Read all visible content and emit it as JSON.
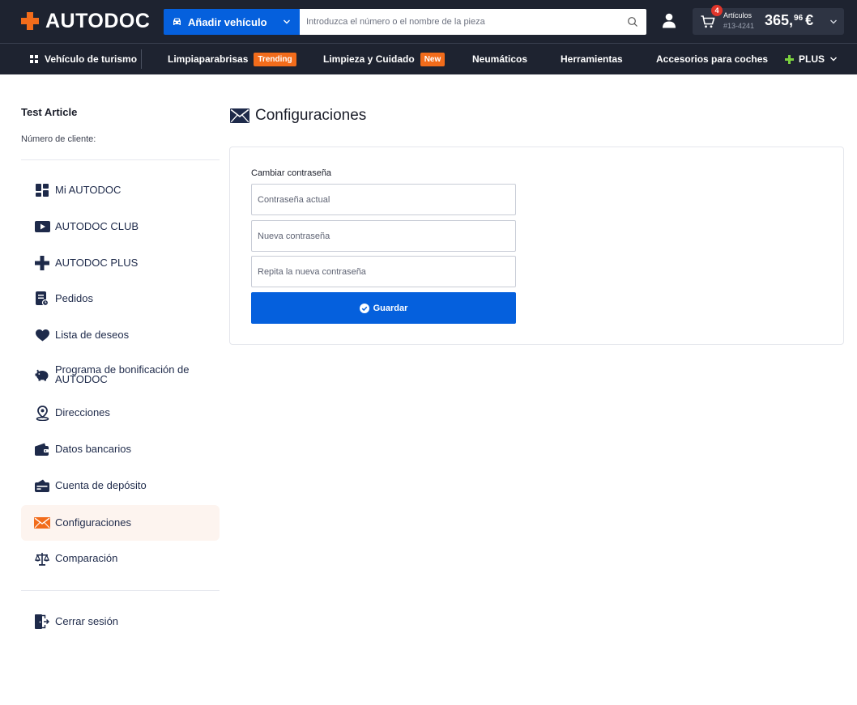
{
  "header": {
    "logo_text": "AUTODOC",
    "vehicle_button_label": "Añadir vehículo",
    "search_placeholder": "Introduzca el número o el nombre de la pieza",
    "cart": {
      "badge_count": "4",
      "items_label": "Artículos",
      "order_number": "#13-4241",
      "price_integer": "365,",
      "price_decimal": "96",
      "currency": "€"
    }
  },
  "nav": {
    "items": [
      {
        "label": "Vehículo de turismo"
      },
      {
        "label": "Limpiaparabrisas",
        "tag": "Trending"
      },
      {
        "label": "Limpieza y Cuidado",
        "tag": "New"
      },
      {
        "label": "Neumáticos"
      },
      {
        "label": "Herramientas"
      },
      {
        "label": "Accesorios para coches"
      },
      {
        "label": "PLUS"
      }
    ]
  },
  "sidebar": {
    "user_name": "Test Article",
    "client_number_label": "Número de cliente:",
    "items": [
      {
        "label": "Mi AUTODOC",
        "icon": "dashboard-icon"
      },
      {
        "label": "AUTODOC CLUB",
        "icon": "play-icon"
      },
      {
        "label": "AUTODOC PLUS",
        "icon": "plus-icon"
      },
      {
        "label": "Pedidos",
        "icon": "orders-icon"
      },
      {
        "label": "Lista de deseos",
        "icon": "heart-icon"
      },
      {
        "label": "Programa de bonificación de AUTODOC",
        "icon": "piggy-bank-icon"
      },
      {
        "label": "Direcciones",
        "icon": "location-icon"
      },
      {
        "label": "Datos bancarios",
        "icon": "wallet-icon"
      },
      {
        "label": "Cuenta de depósito",
        "icon": "deposit-icon"
      },
      {
        "label": "Configuraciones",
        "icon": "envelope-icon",
        "active": true
      },
      {
        "label": "Comparación",
        "icon": "scales-icon"
      }
    ],
    "logout_label": "Cerrar sesión"
  },
  "main": {
    "title": "Configuraciones",
    "form": {
      "section_label": "Cambiar contraseña",
      "current_password_placeholder": "Contraseña actual",
      "new_password_placeholder": "Nueva contraseña",
      "repeat_password_placeholder": "Repita la nueva contraseña",
      "save_label": "Guardar"
    }
  },
  "colors": {
    "header_bg": "#1e2330",
    "brand_orange": "#f26c1b",
    "primary_blue": "#0560dd",
    "plus_green": "#7bd23e",
    "icon_navy": "#1e2a4a",
    "active_bg": "#fdf4ef"
  }
}
